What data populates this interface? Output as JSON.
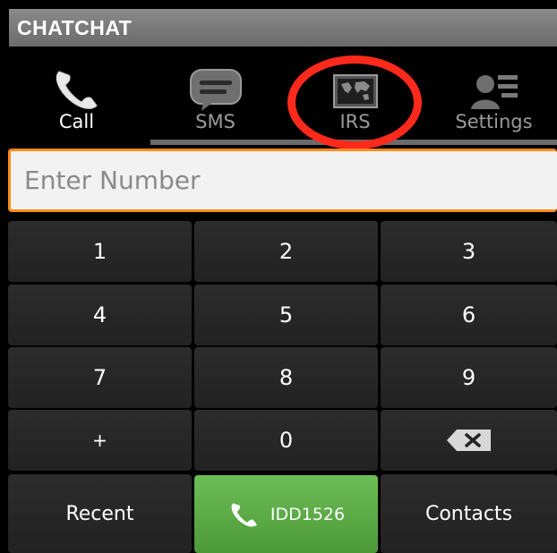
{
  "app": {
    "title": "CHATCHAT"
  },
  "tabs": [
    {
      "label": "Call",
      "icon": "phone-icon",
      "active": true
    },
    {
      "label": "SMS",
      "icon": "chat-bubble-icon",
      "active": false
    },
    {
      "label": "IRS",
      "icon": "world-map-icon",
      "active": false
    },
    {
      "label": "Settings",
      "icon": "user-settings-icon",
      "active": false
    }
  ],
  "dialer": {
    "placeholder": "Enter Number",
    "keys": [
      "1",
      "2",
      "3",
      "4",
      "5",
      "6",
      "7",
      "8",
      "9",
      "+",
      "0"
    ],
    "backspace_icon": "backspace-icon",
    "recent_label": "Recent",
    "call_label": "IDD1526",
    "contacts_label": "Contacts"
  },
  "colors": {
    "accent_orange": "#ff8c1a",
    "call_green": "#5aaa44",
    "annotation_red": "#ff2a1c"
  }
}
